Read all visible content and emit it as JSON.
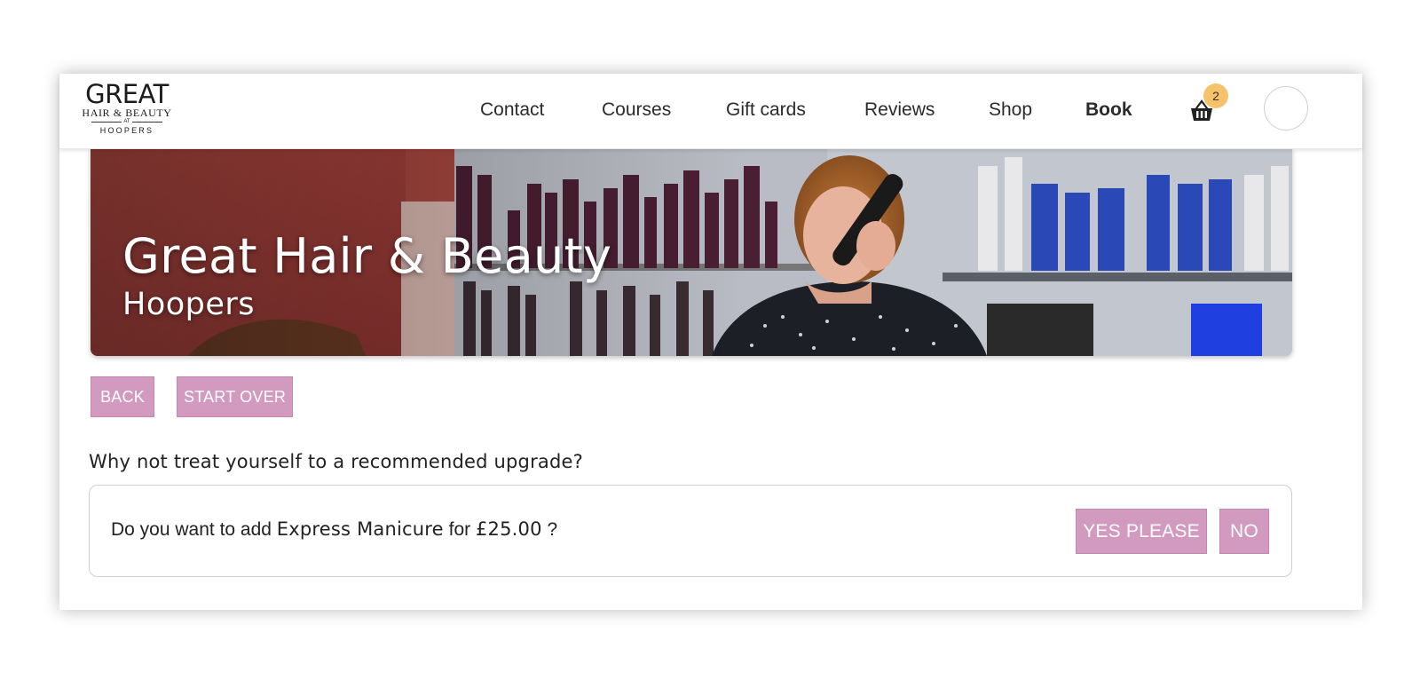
{
  "header": {
    "logo": {
      "line1": "GREAT",
      "line2": "HAIR & BEAUTY",
      "line3": "AT",
      "line4": "HOOPERS"
    },
    "nav": [
      "Contact",
      "Courses",
      "Gift cards",
      "Reviews",
      "Shop",
      "Book"
    ],
    "cart_count": "2"
  },
  "hero": {
    "title": "Great Hair & Beauty",
    "subtitle": "Hoopers"
  },
  "actions": {
    "back": "BACK",
    "start_over": "START OVER"
  },
  "upgrade": {
    "question": "Why not treat yourself to a recommended upgrade?",
    "prefix": "Do you want to add",
    "service": "Express Manicure",
    "for": "for",
    "price": "£25.00",
    "suffix": "?",
    "yes": "YES PLEASE",
    "no": "NO"
  },
  "colors": {
    "button": "#d39ac0",
    "badge": "#f6c36b"
  }
}
